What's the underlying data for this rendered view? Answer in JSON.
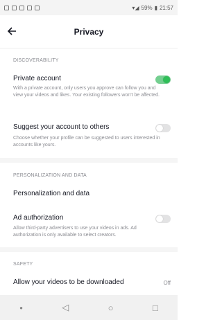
{
  "status_bar": {
    "battery": "59%",
    "time": "21:57"
  },
  "header": {
    "title": "Privacy",
    "back_icon": "arrow-left-icon"
  },
  "sections": {
    "discoverability": {
      "heading": "DISCOVERABILITY",
      "private_account": {
        "title": "Private account",
        "description": "With a private account, only users you approve can follow you and view your videos and likes. Your existing followers won't be affected.",
        "toggle_on": true
      },
      "suggest_account": {
        "title": "Suggest your account to others",
        "description": "Choose whether your profile can be suggested to users interested in accounts like yours.",
        "toggle_on": false
      }
    },
    "personalization": {
      "heading": "PERSONALIZATION AND DATA",
      "personalization_data": {
        "title": "Personalization and data"
      },
      "ad_authorization": {
        "title": "Ad authorization",
        "description": "Allow third-party advertisers to use your videos in ads. Ad authorization is only available to select creators.",
        "toggle_on": false
      }
    },
    "safety": {
      "heading": "SAFETY",
      "allow_download": {
        "title": "Allow your videos to be downloaded",
        "value": "Off"
      }
    }
  },
  "navbar": {
    "back": "◁",
    "home": "○",
    "recents": "□"
  },
  "colors": {
    "toggle_on": "#2fbf58",
    "toggle_off": "#e3e3e4",
    "secondary_text": "#8a8b91"
  }
}
